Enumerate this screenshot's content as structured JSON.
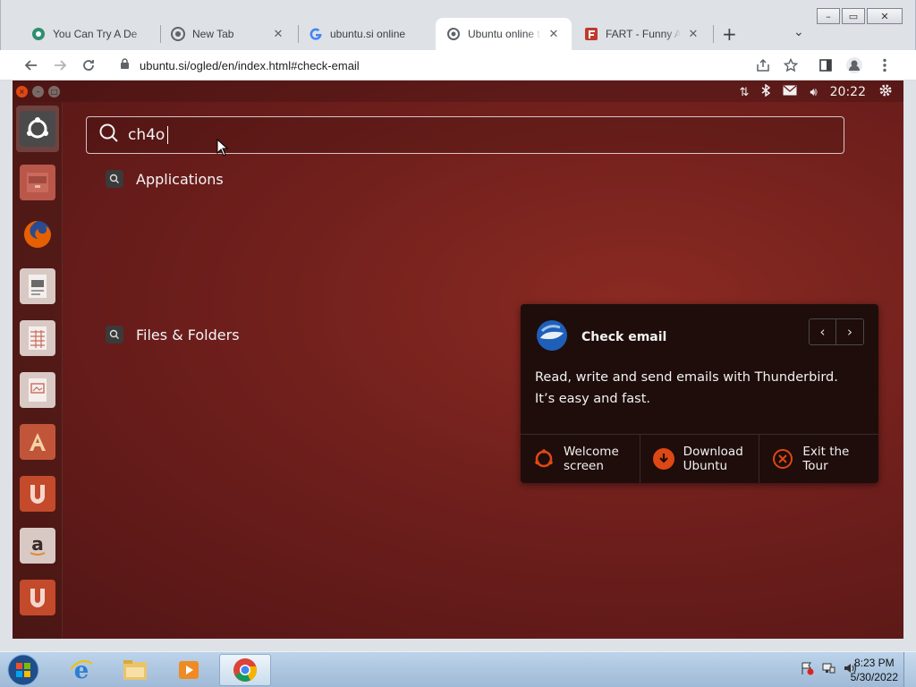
{
  "browser": {
    "tabs": [
      {
        "title": "You Can Try A De",
        "close": "✕",
        "favicon": "pentagon-flower-icon"
      },
      {
        "title": "New Tab",
        "close": "✕",
        "favicon": "chrome-icon"
      },
      {
        "title": "ubuntu.si online",
        "close": "✕",
        "favicon": "google-g-icon"
      },
      {
        "title": "Ubuntu online to",
        "close": "✕",
        "favicon": "globe-icon"
      },
      {
        "title": "FART - Funny An",
        "close": "✕",
        "favicon": "f-logo-icon"
      }
    ],
    "new_tab": "+",
    "tab_menu": "⌄",
    "url": "ubuntu.si/ogled/en/index.html#check-email",
    "window_buttons": {
      "minimize": "–",
      "maximize": "▭",
      "close": "✕"
    }
  },
  "ubuntu": {
    "clock": "20:22",
    "search_query": "ch4o",
    "categories": [
      {
        "label": "Applications"
      },
      {
        "label": "Files & Folders"
      }
    ],
    "launcher_items": [
      "ubuntu-dash",
      "files",
      "firefox",
      "writer",
      "calc",
      "impress",
      "software-center",
      "ubuntu-one",
      "amazon",
      "ubuntu-one-music"
    ],
    "tour": {
      "title": "Check email",
      "prev": "‹",
      "next": "›",
      "description": "Read, write and send emails with Thunderbird. It’s easy and fast.",
      "actions": [
        {
          "label": "Welcome\nscreen",
          "icon": "ubuntu-logo-icon"
        },
        {
          "label": "Download\nUbuntu",
          "icon": "download-icon"
        },
        {
          "label": "Exit the\nTour",
          "icon": "close-circle-icon"
        }
      ]
    }
  },
  "taskbar": {
    "time": "8:23 PM",
    "date": "5/30/2022"
  },
  "colors": {
    "ubuntu_orange": "#dd4814",
    "tour_bg": "#1e0d0b",
    "ubuntu_bg": "#6f1f1c"
  }
}
